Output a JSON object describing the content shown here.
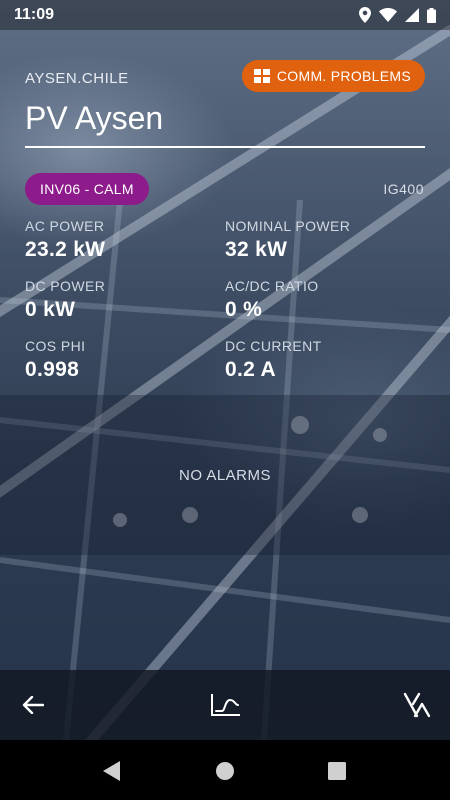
{
  "status_bar": {
    "time": "11:09"
  },
  "header": {
    "site_name": "AYSEN.CHILE",
    "comm_badge": "COMM. PROBLEMS",
    "plant_title": "PV Aysen"
  },
  "inverter": {
    "badge": "INV06 - CALM",
    "model": "IG400",
    "badge_color": "#8e1b8c"
  },
  "metrics": [
    {
      "label": "AC POWER",
      "value": "23.2 kW"
    },
    {
      "label": "NOMINAL POWER",
      "value": "32 kW"
    },
    {
      "label": "DC POWER",
      "value": "0 kW"
    },
    {
      "label": "AC/DC RATIO",
      "value": "0 %"
    },
    {
      "label": "COS PHI",
      "value": "0.998"
    },
    {
      "label": "DC CURRENT",
      "value": "0.2 A"
    }
  ],
  "alarms": {
    "text": "NO ALARMS"
  },
  "toolbar": {
    "icons": [
      "back-arrow-icon",
      "chart-icon",
      "alarm-filter-icon"
    ]
  },
  "colors": {
    "accent_orange": "#e0620f",
    "badge_purple": "#8e1b8c"
  }
}
